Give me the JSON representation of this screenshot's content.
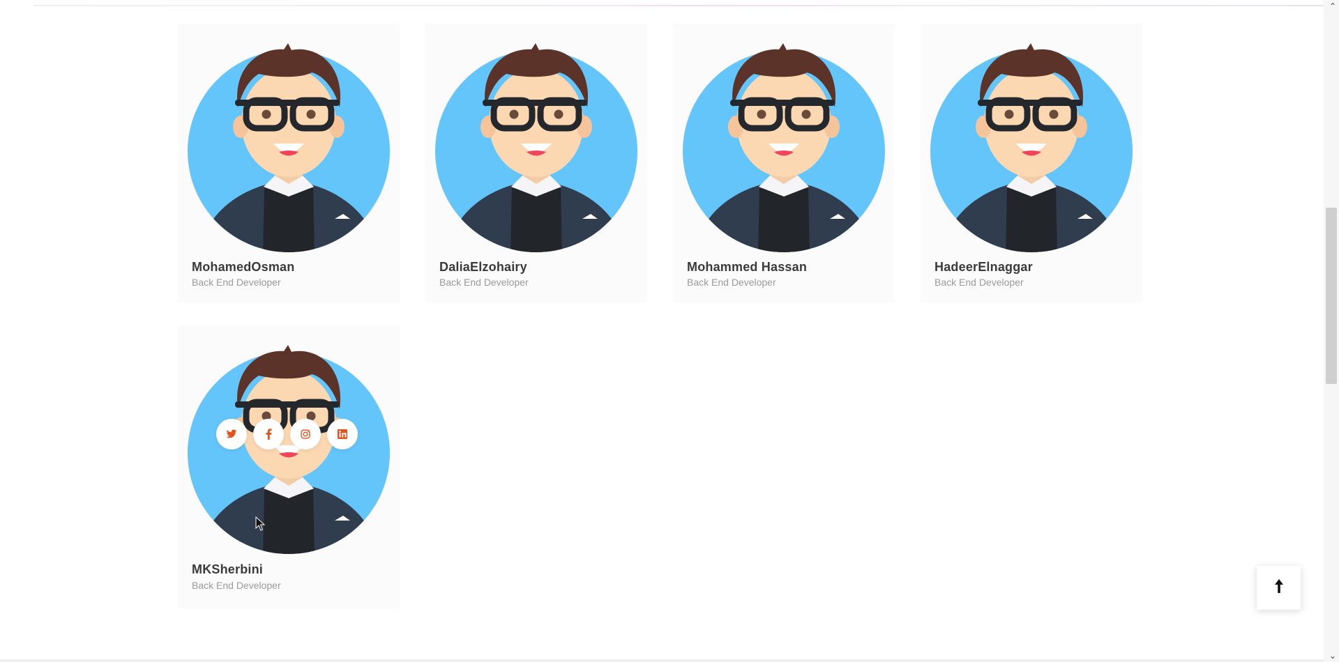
{
  "members": [
    {
      "name": "MohamedOsman",
      "role": "Back End Developer"
    },
    {
      "name": "DaliaElzohairy",
      "role": "Back End Developer"
    },
    {
      "name": "Mohammed Hassan",
      "role": "Back End Developer"
    },
    {
      "name": "HadeerElnaggar",
      "role": "Back End Developer"
    },
    {
      "name": "MKSherbini",
      "role": "Back End Developer"
    }
  ],
  "hover_socials": [
    "twitter-icon",
    "facebook-icon",
    "instagram-icon",
    "linkedin-icon"
  ],
  "colors": {
    "avatar_bg": "#64c5fb",
    "social_icon": "#e2541d",
    "card_bg": "#fbfbfb"
  },
  "icons": {
    "back_to_top": "arrow-up-icon"
  }
}
